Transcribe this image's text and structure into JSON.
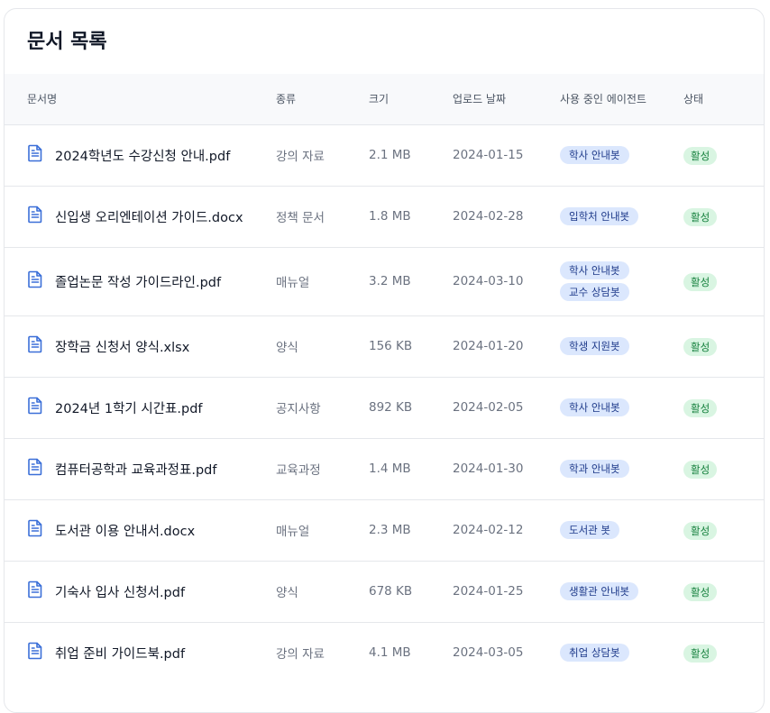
{
  "page": {
    "title": "문서 목록"
  },
  "columns": {
    "name": "문서명",
    "type": "종류",
    "size": "크기",
    "upload_date": "업로드 날짜",
    "agents": "사용 중인 에이전트",
    "status": "상태"
  },
  "icons": {
    "document": "file-text-icon",
    "accent_color": "#3b6fd8"
  },
  "rows": [
    {
      "name": "2024학년도 수강신청 안내.pdf",
      "type": "강의 자료",
      "size": "2.1 MB",
      "date": "2024-01-15",
      "agents": [
        "학사 안내봇"
      ],
      "status": "활성"
    },
    {
      "name": "신입생 오리엔테이션 가이드.docx",
      "type": "정책 문서",
      "size": "1.8 MB",
      "date": "2024-02-28",
      "agents": [
        "입학처 안내봇"
      ],
      "status": "활성"
    },
    {
      "name": "졸업논문 작성 가이드라인.pdf",
      "type": "매뉴얼",
      "size": "3.2 MB",
      "date": "2024-03-10",
      "agents": [
        "학사 안내봇",
        "교수 상담봇"
      ],
      "status": "활성"
    },
    {
      "name": "장학금 신청서 양식.xlsx",
      "type": "양식",
      "size": "156 KB",
      "date": "2024-01-20",
      "agents": [
        "학생 지원봇"
      ],
      "status": "활성"
    },
    {
      "name": "2024년 1학기 시간표.pdf",
      "type": "공지사항",
      "size": "892 KB",
      "date": "2024-02-05",
      "agents": [
        "학사 안내봇"
      ],
      "status": "활성"
    },
    {
      "name": "컴퓨터공학과 교육과정표.pdf",
      "type": "교육과정",
      "size": "1.4 MB",
      "date": "2024-01-30",
      "agents": [
        "학과 안내봇"
      ],
      "status": "활성"
    },
    {
      "name": "도서관 이용 안내서.docx",
      "type": "매뉴얼",
      "size": "2.3 MB",
      "date": "2024-02-12",
      "agents": [
        "도서관 봇"
      ],
      "status": "활성"
    },
    {
      "name": "기숙사 입사 신청서.pdf",
      "type": "양식",
      "size": "678 KB",
      "date": "2024-01-25",
      "agents": [
        "생활관 안내봇"
      ],
      "status": "활성"
    },
    {
      "name": "취업 준비 가이드북.pdf",
      "type": "강의 자료",
      "size": "4.1 MB",
      "date": "2024-03-05",
      "agents": [
        "취업 상담봇"
      ],
      "status": "활성"
    }
  ]
}
